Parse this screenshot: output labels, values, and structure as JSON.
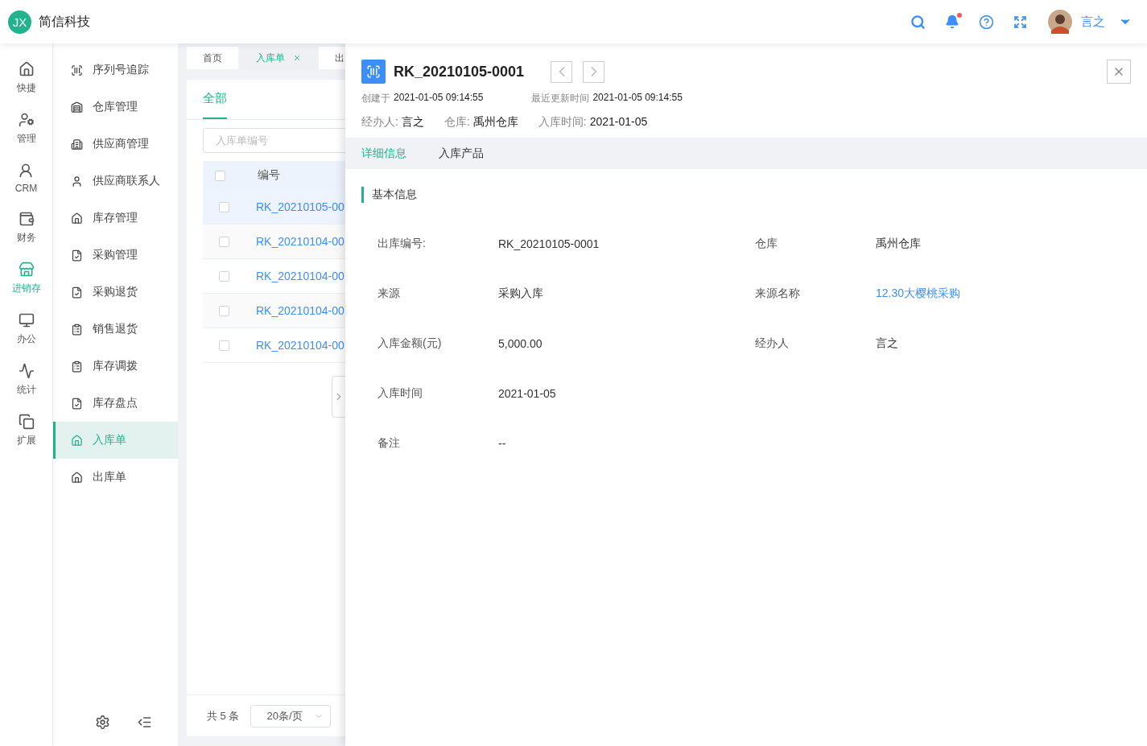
{
  "brand": {
    "logo": "JX",
    "name": "简信科技"
  },
  "header": {
    "notification_dot": true,
    "user": "言之"
  },
  "rail": [
    {
      "label": "快捷",
      "selected": false
    },
    {
      "label": "管理",
      "selected": false
    },
    {
      "label": "CRM",
      "selected": false
    },
    {
      "label": "财务",
      "selected": false
    },
    {
      "label": "进销存",
      "selected": true
    },
    {
      "label": "办公",
      "selected": false
    },
    {
      "label": "统计",
      "selected": false
    },
    {
      "label": "扩展",
      "selected": false
    }
  ],
  "submenu": [
    {
      "label": "序列号追踪",
      "selected": false
    },
    {
      "label": "仓库管理",
      "selected": false
    },
    {
      "label": "供应商管理",
      "selected": false
    },
    {
      "label": "供应商联系人",
      "selected": false
    },
    {
      "label": "库存管理",
      "selected": false
    },
    {
      "label": "采购管理",
      "selected": false
    },
    {
      "label": "采购退货",
      "selected": false
    },
    {
      "label": "销售退货",
      "selected": false
    },
    {
      "label": "库存调拨",
      "selected": false
    },
    {
      "label": "库存盘点",
      "selected": false
    },
    {
      "label": "入库单",
      "selected": true
    },
    {
      "label": "出库单",
      "selected": false
    }
  ],
  "page_tabs": [
    {
      "label": "首页",
      "selected": false,
      "closable": false
    },
    {
      "label": "入库单",
      "selected": true,
      "closable": true
    },
    {
      "label": "出",
      "selected": false,
      "closable": false
    }
  ],
  "list": {
    "filter_tabs": [
      {
        "label": "全部",
        "selected": true
      }
    ],
    "search": {
      "placeholder": "入库单编号"
    },
    "columns": [
      "编号"
    ],
    "all_checked": false,
    "rows": [
      {
        "number": "RK_20210105-00",
        "selected": true,
        "checked": false
      },
      {
        "number": "RK_20210104-00",
        "selected": false,
        "checked": false
      },
      {
        "number": "RK_20210104-00",
        "selected": false,
        "checked": false
      },
      {
        "number": "RK_20210104-00",
        "selected": false,
        "checked": false
      },
      {
        "number": "RK_20210104-00",
        "selected": false,
        "checked": false
      }
    ],
    "total": "共 5 条",
    "page_size": "20条/页"
  },
  "detail": {
    "title": "RK_20210105-0001",
    "created_label": "创建于",
    "created": "2021-01-05 09:14:55",
    "updated_label": "最近更新时间",
    "updated": "2021-01-05 09:14:55",
    "summary": [
      {
        "label": "经办人:",
        "value": "言之"
      },
      {
        "label": "仓库:",
        "value": "禹州仓库"
      },
      {
        "label": "入库时间:",
        "value": "2021-01-05"
      }
    ],
    "tabs": [
      {
        "label": "详细信息",
        "selected": true
      },
      {
        "label": "入库产品",
        "selected": false
      }
    ],
    "section": "基本信息",
    "fields": [
      [
        {
          "label": "出库编号:",
          "value": "RK_20210105-0001",
          "kind": "text"
        },
        {
          "label": "仓库",
          "value": "禹州仓库",
          "kind": "text"
        }
      ],
      [
        {
          "label": "来源",
          "value": "采购入库",
          "kind": "text"
        },
        {
          "label": "来源名称",
          "value": "12.30大樱桃采购",
          "kind": "link"
        }
      ],
      [
        {
          "label": "入库金额(元)",
          "value": "5,000.00",
          "kind": "text"
        },
        {
          "label": "经办人",
          "value": "言之",
          "kind": "text"
        }
      ],
      [
        {
          "label": "入库时间",
          "value": "2021-01-05",
          "kind": "text"
        }
      ],
      [
        {
          "label": "备注",
          "value": "--",
          "kind": "text"
        }
      ]
    ]
  }
}
